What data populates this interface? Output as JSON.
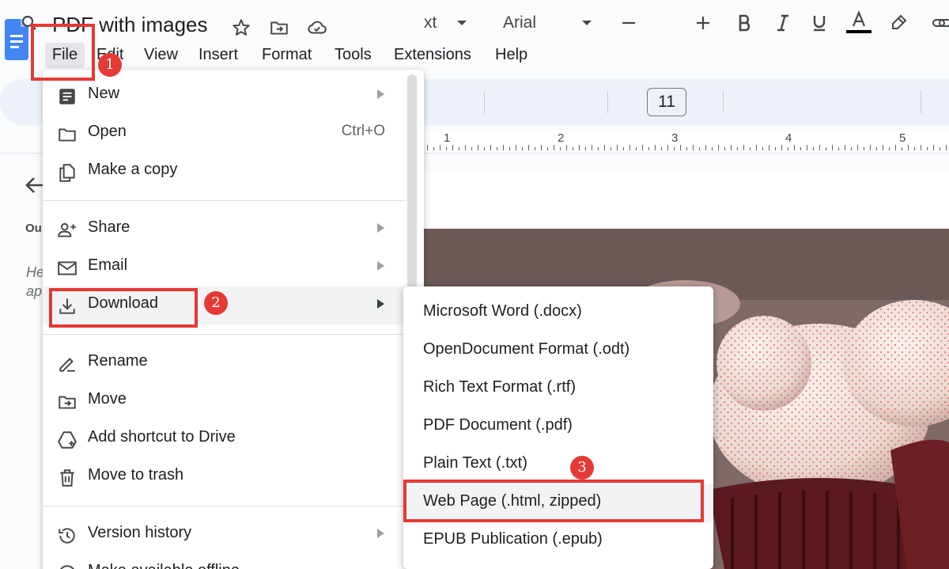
{
  "document": {
    "title": "PDF with images"
  },
  "menubar": {
    "items": [
      "File",
      "Edit",
      "View",
      "Insert",
      "Format",
      "Tools",
      "Extensions",
      "Help"
    ]
  },
  "toolbar": {
    "style_fragment": "xt",
    "font_name": "Arial",
    "font_size": "11",
    "text_color": "#000000"
  },
  "ruler": {
    "numbers": [
      "1",
      "2",
      "3",
      "4",
      "5"
    ]
  },
  "outline": {
    "label": "Ou",
    "hint_line1": "He",
    "hint_line2": "ap"
  },
  "file_menu": {
    "new": "New",
    "open": "Open",
    "open_shortcut": "Ctrl+O",
    "make_copy": "Make a copy",
    "share": "Share",
    "email": "Email",
    "download": "Download",
    "rename": "Rename",
    "move": "Move",
    "add_shortcut": "Add shortcut to Drive",
    "move_to_trash": "Move to trash",
    "version_history": "Version history",
    "make_available_offline": "Make available offline"
  },
  "download_menu": {
    "items": [
      "Microsoft Word (.docx)",
      "OpenDocument Format (.odt)",
      "Rich Text Format (.rtf)",
      "PDF Document (.pdf)",
      "Plain Text (.txt)",
      "Web Page (.html, zipped)",
      "EPUB Publication (.epub)"
    ]
  },
  "annotations": {
    "step1": "1",
    "step2": "2",
    "step3": "3",
    "color": "#e53935"
  }
}
